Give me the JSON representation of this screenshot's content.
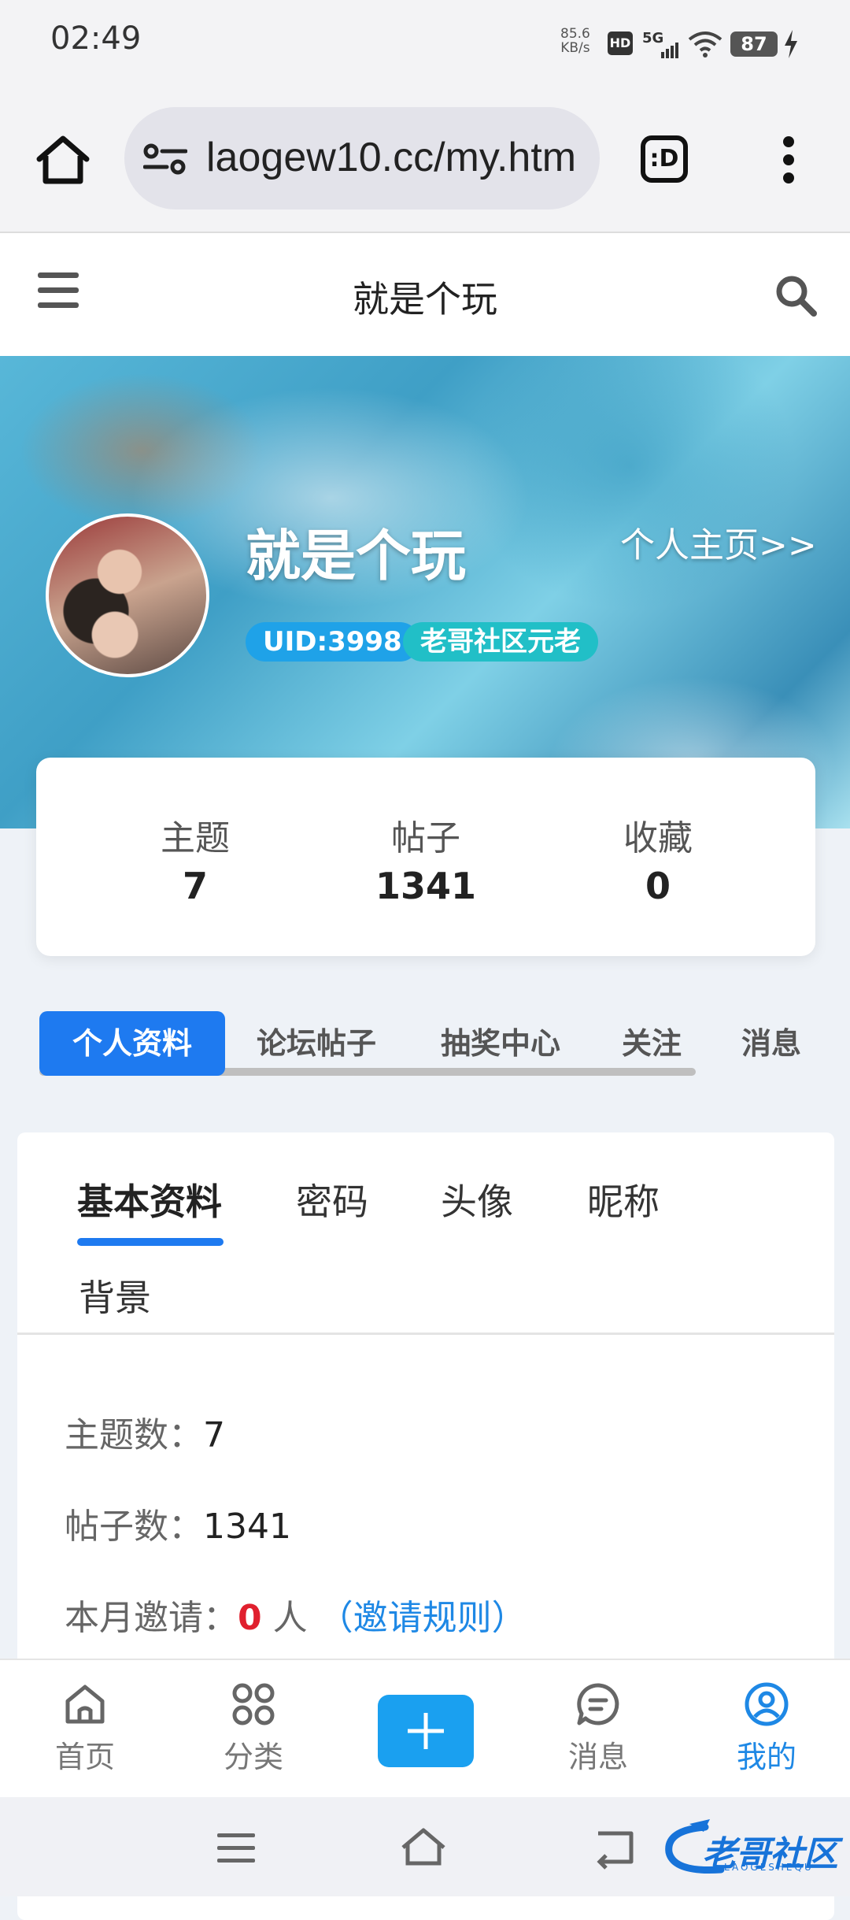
{
  "status_bar": {
    "time": "02:49",
    "speed_value": "85.6",
    "speed_unit": "KB/s",
    "hd": "HD",
    "network": "5G",
    "battery": "87"
  },
  "browser": {
    "url": "laogew10.cc/my.htm",
    "tab_icon_text": ":D"
  },
  "site": {
    "title": "就是个玩"
  },
  "profile": {
    "name": "就是个玩",
    "profile_link": "个人主页>>",
    "uid": "UID:3998",
    "rank": "老哥社区元老"
  },
  "stats": [
    {
      "label": "主题",
      "value": "7"
    },
    {
      "label": "帖子",
      "value": "1341"
    },
    {
      "label": "收藏",
      "value": "0"
    }
  ],
  "tabs": [
    "个人资料",
    "论坛帖子",
    "抽奖中心",
    "关注",
    "消息"
  ],
  "subtabs": [
    "基本资料",
    "密码",
    "头像",
    "昵称",
    "背景"
  ],
  "info": {
    "topics_label": "主题数：",
    "topics_value": "7",
    "posts_label": "帖子数：",
    "posts_value": "1341",
    "invite_label": "本月邀请：",
    "invite_count": "0",
    "invite_unit": "人",
    "invite_rules": "（邀请规则）"
  },
  "bottom_nav": {
    "home": "首页",
    "category": "分类",
    "messages": "消息",
    "mine": "我的"
  },
  "watermark": {
    "text": "老哥社区",
    "sub": "LAOGESHEQU"
  },
  "colors": {
    "accent": "#1e7af0",
    "invite_red": "#e0202e",
    "link_blue": "#1e88e5"
  }
}
